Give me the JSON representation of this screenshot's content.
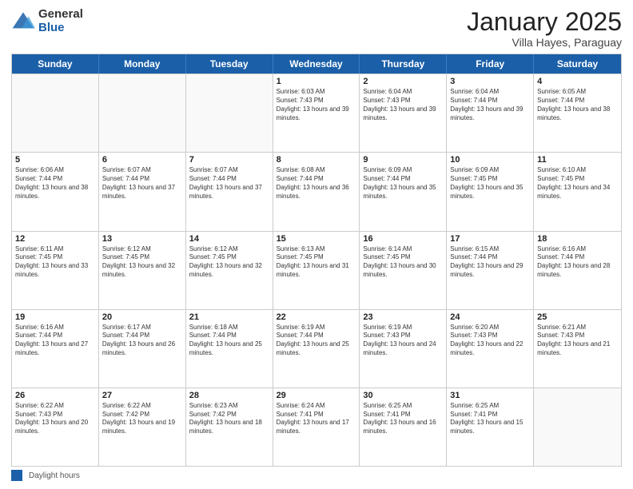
{
  "logo": {
    "general": "General",
    "blue": "Blue"
  },
  "title": {
    "month": "January 2025",
    "location": "Villa Hayes, Paraguay"
  },
  "weekdays": [
    "Sunday",
    "Monday",
    "Tuesday",
    "Wednesday",
    "Thursday",
    "Friday",
    "Saturday"
  ],
  "weeks": [
    [
      {
        "day": "",
        "info": ""
      },
      {
        "day": "",
        "info": ""
      },
      {
        "day": "",
        "info": ""
      },
      {
        "day": "1",
        "info": "Sunrise: 6:03 AM\nSunset: 7:43 PM\nDaylight: 13 hours and 39 minutes."
      },
      {
        "day": "2",
        "info": "Sunrise: 6:04 AM\nSunset: 7:43 PM\nDaylight: 13 hours and 39 minutes."
      },
      {
        "day": "3",
        "info": "Sunrise: 6:04 AM\nSunset: 7:44 PM\nDaylight: 13 hours and 39 minutes."
      },
      {
        "day": "4",
        "info": "Sunrise: 6:05 AM\nSunset: 7:44 PM\nDaylight: 13 hours and 38 minutes."
      }
    ],
    [
      {
        "day": "5",
        "info": "Sunrise: 6:06 AM\nSunset: 7:44 PM\nDaylight: 13 hours and 38 minutes."
      },
      {
        "day": "6",
        "info": "Sunrise: 6:07 AM\nSunset: 7:44 PM\nDaylight: 13 hours and 37 minutes."
      },
      {
        "day": "7",
        "info": "Sunrise: 6:07 AM\nSunset: 7:44 PM\nDaylight: 13 hours and 37 minutes."
      },
      {
        "day": "8",
        "info": "Sunrise: 6:08 AM\nSunset: 7:44 PM\nDaylight: 13 hours and 36 minutes."
      },
      {
        "day": "9",
        "info": "Sunrise: 6:09 AM\nSunset: 7:44 PM\nDaylight: 13 hours and 35 minutes."
      },
      {
        "day": "10",
        "info": "Sunrise: 6:09 AM\nSunset: 7:45 PM\nDaylight: 13 hours and 35 minutes."
      },
      {
        "day": "11",
        "info": "Sunrise: 6:10 AM\nSunset: 7:45 PM\nDaylight: 13 hours and 34 minutes."
      }
    ],
    [
      {
        "day": "12",
        "info": "Sunrise: 6:11 AM\nSunset: 7:45 PM\nDaylight: 13 hours and 33 minutes."
      },
      {
        "day": "13",
        "info": "Sunrise: 6:12 AM\nSunset: 7:45 PM\nDaylight: 13 hours and 32 minutes."
      },
      {
        "day": "14",
        "info": "Sunrise: 6:12 AM\nSunset: 7:45 PM\nDaylight: 13 hours and 32 minutes."
      },
      {
        "day": "15",
        "info": "Sunrise: 6:13 AM\nSunset: 7:45 PM\nDaylight: 13 hours and 31 minutes."
      },
      {
        "day": "16",
        "info": "Sunrise: 6:14 AM\nSunset: 7:45 PM\nDaylight: 13 hours and 30 minutes."
      },
      {
        "day": "17",
        "info": "Sunrise: 6:15 AM\nSunset: 7:44 PM\nDaylight: 13 hours and 29 minutes."
      },
      {
        "day": "18",
        "info": "Sunrise: 6:16 AM\nSunset: 7:44 PM\nDaylight: 13 hours and 28 minutes."
      }
    ],
    [
      {
        "day": "19",
        "info": "Sunrise: 6:16 AM\nSunset: 7:44 PM\nDaylight: 13 hours and 27 minutes."
      },
      {
        "day": "20",
        "info": "Sunrise: 6:17 AM\nSunset: 7:44 PM\nDaylight: 13 hours and 26 minutes."
      },
      {
        "day": "21",
        "info": "Sunrise: 6:18 AM\nSunset: 7:44 PM\nDaylight: 13 hours and 25 minutes."
      },
      {
        "day": "22",
        "info": "Sunrise: 6:19 AM\nSunset: 7:44 PM\nDaylight: 13 hours and 25 minutes."
      },
      {
        "day": "23",
        "info": "Sunrise: 6:19 AM\nSunset: 7:43 PM\nDaylight: 13 hours and 24 minutes."
      },
      {
        "day": "24",
        "info": "Sunrise: 6:20 AM\nSunset: 7:43 PM\nDaylight: 13 hours and 22 minutes."
      },
      {
        "day": "25",
        "info": "Sunrise: 6:21 AM\nSunset: 7:43 PM\nDaylight: 13 hours and 21 minutes."
      }
    ],
    [
      {
        "day": "26",
        "info": "Sunrise: 6:22 AM\nSunset: 7:43 PM\nDaylight: 13 hours and 20 minutes."
      },
      {
        "day": "27",
        "info": "Sunrise: 6:22 AM\nSunset: 7:42 PM\nDaylight: 13 hours and 19 minutes."
      },
      {
        "day": "28",
        "info": "Sunrise: 6:23 AM\nSunset: 7:42 PM\nDaylight: 13 hours and 18 minutes."
      },
      {
        "day": "29",
        "info": "Sunrise: 6:24 AM\nSunset: 7:41 PM\nDaylight: 13 hours and 17 minutes."
      },
      {
        "day": "30",
        "info": "Sunrise: 6:25 AM\nSunset: 7:41 PM\nDaylight: 13 hours and 16 minutes."
      },
      {
        "day": "31",
        "info": "Sunrise: 6:25 AM\nSunset: 7:41 PM\nDaylight: 13 hours and 15 minutes."
      },
      {
        "day": "",
        "info": ""
      }
    ]
  ],
  "footer": {
    "daylight_label": "Daylight hours"
  }
}
